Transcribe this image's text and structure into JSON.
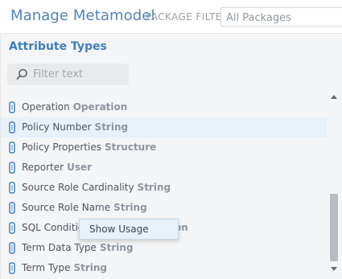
{
  "header": {
    "title": "Manage Metamodel",
    "filter_label": "PACKAGE FILTER",
    "package_filter": {
      "placeholder": "All Packages"
    }
  },
  "panel": {
    "title": "Attribute Types",
    "search": {
      "placeholder": "Filter text"
    }
  },
  "list": {
    "items": [
      {
        "name": "Operation",
        "type": "Operation",
        "selected": false
      },
      {
        "name": "Policy Number",
        "type": "String",
        "selected": true
      },
      {
        "name": "Policy Properties",
        "type": "Structure",
        "selected": false
      },
      {
        "name": "Reporter",
        "type": "User",
        "selected": false
      },
      {
        "name": "Source Role Cardinality",
        "type": "String",
        "selected": false
      },
      {
        "name": "Source Role Name",
        "type": "String",
        "selected": false
      },
      {
        "name": "SQL Condition Type",
        "type": "Enumeration",
        "selected": false
      },
      {
        "name": "Term Data Type",
        "type": "String",
        "selected": false
      },
      {
        "name": "Term Type",
        "type": "String",
        "selected": false
      }
    ]
  },
  "context_menu": {
    "items": [
      {
        "label": "Show Usage"
      }
    ]
  },
  "colors": {
    "brand": "#4f84b9",
    "panel_title": "#3f7fba",
    "selected_row": "#e6f1fa",
    "panel_background": "#f4f5f6"
  },
  "icons": {
    "search": "search-icon",
    "attribute_type": "attribute-type-icon"
  }
}
